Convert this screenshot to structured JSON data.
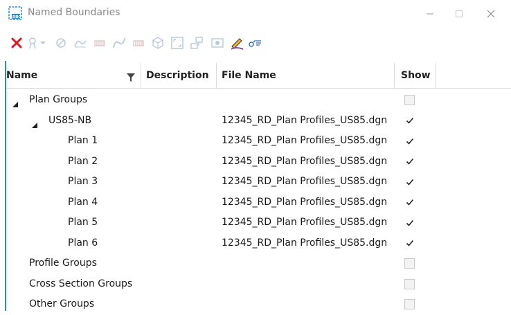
{
  "window": {
    "title": "Named Boundaries",
    "app_icon": "named-boundaries-app-icon",
    "controls": [
      "minimize",
      "maximize",
      "close"
    ]
  },
  "toolbar": {
    "buttons": [
      {
        "icon": "delete-icon",
        "enabled": true
      },
      {
        "icon": "place-boundary-icon",
        "enabled": false
      },
      {
        "icon": "dropdown-arrow-icon",
        "enabled": false
      },
      {
        "icon": "civil-boundary-icon",
        "enabled": false
      },
      {
        "icon": "profile-boundary-icon",
        "enabled": false
      },
      {
        "icon": "grid-boundary-icon",
        "enabled": false
      },
      {
        "icon": "curve-boundary-icon",
        "enabled": false
      },
      {
        "icon": "grid-boundary-2-icon",
        "enabled": false
      },
      {
        "icon": "3d-boundary-icon",
        "enabled": false
      },
      {
        "icon": "fit-boundary-icon",
        "enabled": false
      },
      {
        "icon": "create-drawings-icon",
        "enabled": false
      },
      {
        "icon": "view-boundary-icon",
        "enabled": false
      },
      {
        "icon": "edit-pencil-icon",
        "enabled": true
      },
      {
        "icon": "properties-icon",
        "enabled": true
      }
    ]
  },
  "table": {
    "columns": {
      "name": "Name",
      "description": "Description",
      "file_name": "File Name",
      "show": "Show"
    },
    "rows": [
      {
        "label": "Plan Groups",
        "file": "",
        "show": false,
        "expanded": true
      },
      {
        "label": "US85-NB",
        "file": "12345_RD_Plan Profiles_US85.dgn",
        "show": true,
        "expanded": true
      },
      {
        "label": "Plan 1",
        "file": "12345_RD_Plan Profiles_US85.dgn",
        "show": true
      },
      {
        "label": "Plan 2",
        "file": "12345_RD_Plan Profiles_US85.dgn",
        "show": true
      },
      {
        "label": "Plan 3",
        "file": "12345_RD_Plan Profiles_US85.dgn",
        "show": true
      },
      {
        "label": "Plan 4",
        "file": "12345_RD_Plan Profiles_US85.dgn",
        "show": true
      },
      {
        "label": "Plan 5",
        "file": "12345_RD_Plan Profiles_US85.dgn",
        "show": true
      },
      {
        "label": "Plan 6",
        "file": "12345_RD_Plan Profiles_US85.dgn",
        "show": true
      },
      {
        "label": "Profile Groups",
        "file": "",
        "show": false
      },
      {
        "label": "Cross Section Groups",
        "file": "",
        "show": false
      },
      {
        "label": "Other Groups",
        "file": "",
        "show": false
      }
    ]
  },
  "colors": {
    "accent": "#2b88d8",
    "delete": "#e81123",
    "disabled_icon": "#b9c9dc",
    "header_divider": "#d9d9d9"
  }
}
